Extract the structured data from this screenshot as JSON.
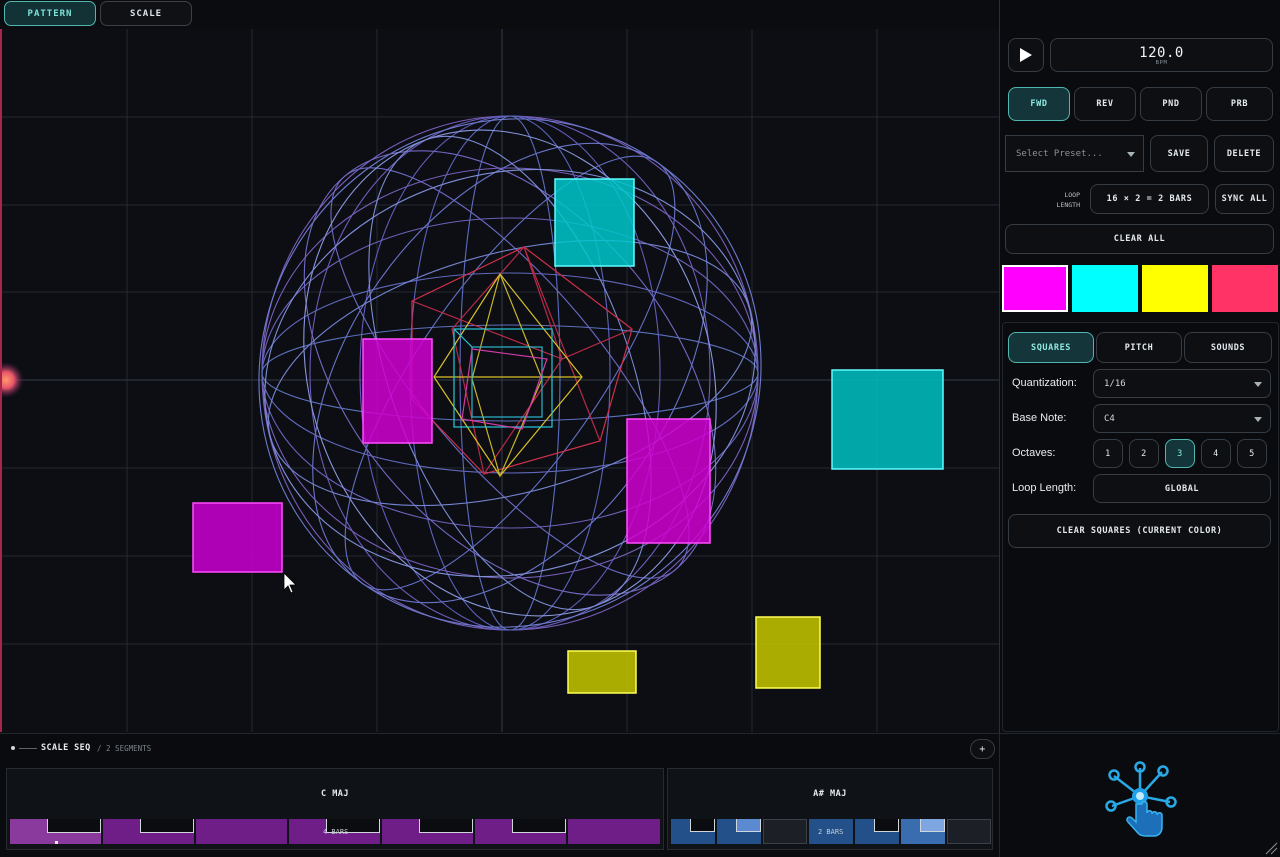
{
  "top_tabs": [
    {
      "label": "PATTERN",
      "active": true
    },
    {
      "label": "SCALE",
      "active": false
    }
  ],
  "transport": {
    "bpm_value": "120.0",
    "bpm_unit": "BPM",
    "play_icon": "play-icon"
  },
  "direction_buttons": [
    {
      "label": "FWD",
      "active": true
    },
    {
      "label": "REV",
      "active": false
    },
    {
      "label": "PND",
      "active": false
    },
    {
      "label": "PRB",
      "active": false
    }
  ],
  "preset": {
    "placeholder": "Select Preset...",
    "save_label": "SAVE",
    "delete_label": "DELETE"
  },
  "loop": {
    "label_line1": "LOOP",
    "label_line2": "LENGTH",
    "value": "16 × 2 = 2 BARS",
    "sync_label": "SYNC ALL",
    "clear_all_label": "CLEAR ALL"
  },
  "colors": {
    "magenta": "#ff00ff",
    "cyan": "#00ffff",
    "yellow": "#ffff00",
    "red": "#ff3366",
    "selected": "magenta"
  },
  "sub_tabs": [
    {
      "label": "SQUARES",
      "active": true
    },
    {
      "label": "PITCH",
      "active": false
    },
    {
      "label": "SOUNDS",
      "active": false
    }
  ],
  "settings": {
    "quantization_label": "Quantization:",
    "quantization_value": "1/16",
    "base_note_label": "Base Note:",
    "base_note_value": "C4",
    "octaves_label": "Octaves:",
    "octaves": [
      "1",
      "2",
      "3",
      "4",
      "5"
    ],
    "octave_selected": "3",
    "loop_length_label": "Loop Length:",
    "loop_length_value": "GLOBAL",
    "clear_squares_label": "CLEAR SQUARES (CURRENT COLOR)"
  },
  "sequencer": {
    "title": "SCALE SEQ",
    "subtitle": "/ 2 SEGMENTS",
    "add_label": "+",
    "segments": [
      {
        "name": "C MAJ",
        "bars_label": "4 BARS",
        "color": "#7a2590"
      },
      {
        "name": "A# MAJ",
        "bars_label": "2 BARS",
        "color": "#254f84"
      }
    ]
  }
}
